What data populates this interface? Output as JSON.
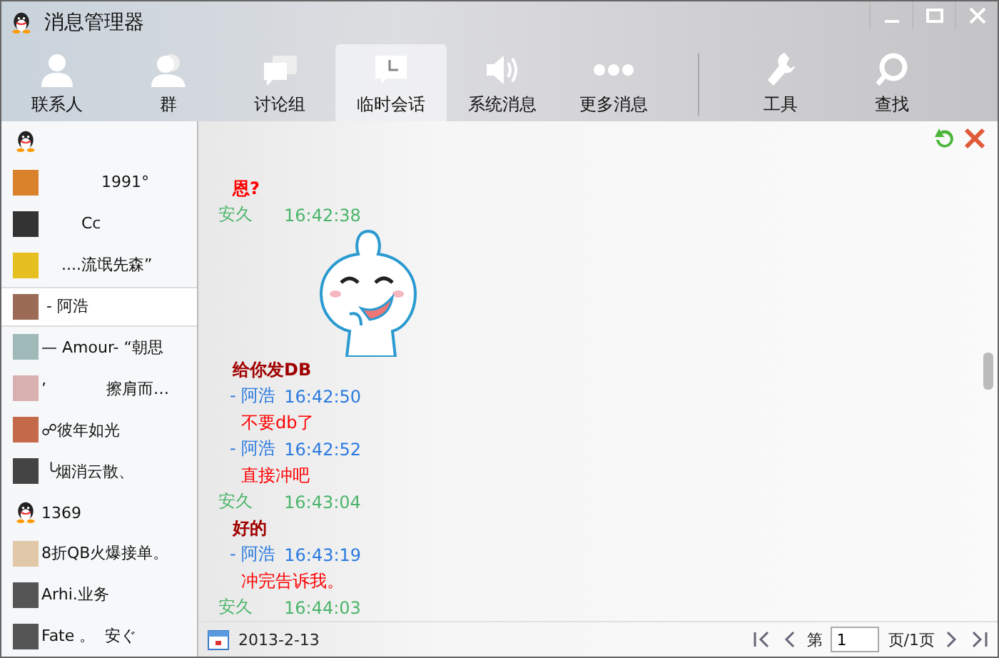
{
  "window": {
    "title": "消息管理器"
  },
  "tabs": [
    {
      "label": "联系人",
      "selected": false
    },
    {
      "label": "群",
      "selected": false
    },
    {
      "label": "讨论组",
      "selected": false
    },
    {
      "label": "临时会话",
      "selected": true
    },
    {
      "label": "系统消息",
      "selected": false
    },
    {
      "label": "更多消息",
      "selected": false
    }
  ],
  "tools": [
    {
      "label": "工具"
    },
    {
      "label": "查找"
    }
  ],
  "contacts": [
    {
      "kind": "penguin",
      "selected": false
    },
    {
      "name": "            1991°",
      "kind": "photo",
      "selected": false
    },
    {
      "name": "        Cc",
      "kind": "photo",
      "selected": false
    },
    {
      "name": "    ....流氓先森”",
      "kind": "photo",
      "selected": false
    },
    {
      "name": " - 阿浩",
      "kind": "photo",
      "selected": true
    },
    {
      "name": "— Amour- “朝思",
      "kind": "photo",
      "selected": false
    },
    {
      "name": "’            擦肩而…",
      "kind": "photo",
      "selected": false
    },
    {
      "name": "☍彼年如光",
      "kind": "photo",
      "selected": false
    },
    {
      "name": " ╰烟消云散、",
      "kind": "photo",
      "selected": false
    },
    {
      "name": "1369",
      "kind": "penguin",
      "selected": false
    },
    {
      "name": "8折QB火爆接单。",
      "kind": "photo",
      "selected": false
    },
    {
      "name": "Arhi.业务",
      "kind": "photo",
      "selected": false
    },
    {
      "name": "Fate 。  安ぐ",
      "kind": "photo",
      "selected": false
    }
  ],
  "messages": [
    {
      "kind": "peer_text",
      "text": "恩?"
    },
    {
      "kind": "self_header",
      "sender": "安久",
      "time": "16:42:38"
    },
    {
      "kind": "sticker"
    },
    {
      "kind": "self_text",
      "text": "给你发DB"
    },
    {
      "kind": "peer_header",
      "sender": "- 阿浩",
      "time": "16:42:50"
    },
    {
      "kind": "peer_text",
      "text": "不要db了"
    },
    {
      "kind": "peer_header",
      "sender": "- 阿浩",
      "time": "16:42:52"
    },
    {
      "kind": "peer_text",
      "text": "直接冲吧"
    },
    {
      "kind": "self_header",
      "sender": "安久",
      "time": "16:43:04"
    },
    {
      "kind": "self_text",
      "text": "好的"
    },
    {
      "kind": "peer_header",
      "sender": "- 阿浩",
      "time": "16:43:19"
    },
    {
      "kind": "peer_text",
      "text": "冲完告诉我。"
    },
    {
      "kind": "self_header",
      "sender": "安久",
      "time": "16:44:03"
    }
  ],
  "footer": {
    "date": "2013-2-13",
    "page_prefix": "第",
    "page": "1",
    "page_suffix": "页/1页"
  }
}
